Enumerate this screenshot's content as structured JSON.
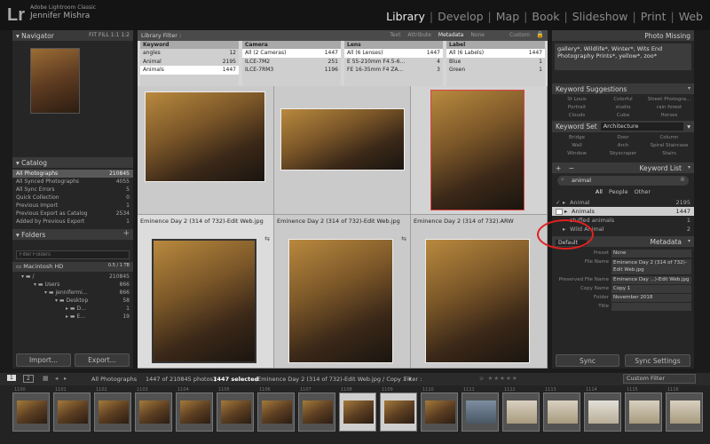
{
  "header": {
    "logo": "Lr",
    "app": "Adobe Lightroom Classic",
    "user": "Jennifer Mishra",
    "modules": [
      "Library",
      "Develop",
      "Map",
      "Book",
      "Slideshow",
      "Print",
      "Web"
    ]
  },
  "navigator": {
    "title": "Navigator",
    "zoom": "FIT   FILL   1:1   1:2"
  },
  "catalog": {
    "title": "Catalog",
    "rows": [
      {
        "label": "All Photographs",
        "count": "210845"
      },
      {
        "label": "All Synced Photographs",
        "count": "4055"
      },
      {
        "label": "All Sync Errors",
        "count": "5"
      },
      {
        "label": "Quick Collection",
        "count": "0"
      },
      {
        "label": "Previous Import",
        "count": "1"
      },
      {
        "label": "Previous Export as Catalog",
        "count": "2534"
      },
      {
        "label": "Added by Previous Export",
        "count": "1"
      }
    ]
  },
  "folders": {
    "title": "Folders",
    "plus": "+",
    "filter_placeholder": "Filter Folders",
    "volume": "Macintosh HD",
    "volume_size": "0.5 / 1 TB",
    "rows": [
      {
        "label": "/",
        "count": "210845"
      },
      {
        "label": "Users",
        "count": "866"
      },
      {
        "label": "jennifermi...",
        "count": "866"
      },
      {
        "label": "Desktop",
        "count": "58"
      },
      {
        "label": "D...",
        "count": "1"
      },
      {
        "label": "E...",
        "count": "19"
      }
    ]
  },
  "left_buttons": {
    "import": "Import...",
    "export": "Export..."
  },
  "library_filter": {
    "title": "Library Filter :",
    "tabs": [
      "Text",
      "Attribute",
      "Metadata",
      "None"
    ],
    "preset": "Custom"
  },
  "filter_columns": [
    {
      "header": "Keyword",
      "rows": [
        {
          "label": "angles",
          "count": "12"
        },
        {
          "label": "Animal",
          "count": "2195"
        },
        {
          "label": "Animals",
          "count": "1447"
        }
      ]
    },
    {
      "header": "Camera",
      "rows": [
        {
          "label": "All (2 Cameras)",
          "count": "1447"
        },
        {
          "label": "ILCE-7M2",
          "count": "251"
        },
        {
          "label": "ILCE-7RM3",
          "count": "1196"
        }
      ]
    },
    {
      "header": "Lens",
      "rows": [
        {
          "label": "All (6 Lenses)",
          "count": "1447"
        },
        {
          "label": "E 55-210mm F4.5-6...",
          "count": "4"
        },
        {
          "label": "FE 16-35mm F4 ZA...",
          "count": "3"
        }
      ]
    },
    {
      "header": "Label",
      "rows": [
        {
          "label": "All (6 Labels)",
          "count": "1447"
        },
        {
          "label": "Blue",
          "count": "1"
        },
        {
          "label": "Green",
          "count": "1"
        }
      ]
    }
  ],
  "grid": {
    "captions": [
      "Eminence Day 2 (314 of 732)-Edit Web.jpg",
      "Eminence Day 2 (314 of 732)-Edit Web.jpg",
      "Eminence Day 2 (314 of 732).ARW"
    ]
  },
  "right": {
    "photo_missing": "Photo Missing",
    "keywords_text": "gallery*, Wildlife*, Winter*, Wits End Photography Prints*, yellow*, zoo*",
    "keyword_suggestions": {
      "title": "Keyword Suggestions",
      "items": [
        "St Louis",
        "Colorful",
        "Street Photogra...",
        "Portrait",
        "studio",
        "rain forest",
        "Clouds",
        "Cuba",
        "Horses"
      ]
    },
    "keyword_set": {
      "label": "Keyword Set",
      "value": "Architecture",
      "items": [
        "Bridge",
        "Door",
        "Column",
        "Wall",
        "Arch",
        "Spiral Staircase",
        "Window",
        "Skyscraper",
        "Stairs"
      ]
    },
    "keyword_list": {
      "title": "Keyword List",
      "plus": "+",
      "minus": "−",
      "search": "animal",
      "tabs": [
        "All",
        "People",
        "Other"
      ],
      "rows": [
        {
          "label": "Animal",
          "count": "2195"
        },
        {
          "label": "Animals",
          "count": "1447"
        },
        {
          "label": "stuffed animals",
          "count": "1"
        },
        {
          "label": "Wild Animal",
          "count": "2"
        }
      ]
    },
    "metadata": {
      "title": "Metadata",
      "default": "Default",
      "preset_label": "Preset",
      "preset_value": "None",
      "rows": [
        {
          "k": "File Name",
          "v": "Eminence Day 2 (314 of 732)-Edit Web.jpg"
        },
        {
          "k": "Preserved File Name",
          "v": "Eminence Day ...)-Edit Web.jpg"
        },
        {
          "k": "Copy Name",
          "v": "Copy 1"
        },
        {
          "k": "Folder",
          "v": "November 2018"
        },
        {
          "k": "Title",
          "v": ""
        }
      ]
    },
    "sync": "Sync",
    "sync_settings": "Sync Settings"
  },
  "filmbar": {
    "pages": [
      "1",
      "2"
    ],
    "source": "All Photographs",
    "stats": "1447 of 210845 photos /",
    "selected": "1447 selected",
    "path": "/Eminence Day 2 (314 of 732)-Edit Web.jpg / Copy 1 ▾",
    "filter": "Filter :",
    "custom": "Custom Filter"
  },
  "filmstrip": {
    "numbers": [
      "1100",
      "1101",
      "1102",
      "1103",
      "1104",
      "1105",
      "1106",
      "1107",
      "1108",
      "1109",
      "1110",
      "1111",
      "1112",
      "1113",
      "1114",
      "1115",
      "1116"
    ]
  },
  "colors": {
    "accent": "#e8e8e8",
    "annotation": "#e02020"
  }
}
